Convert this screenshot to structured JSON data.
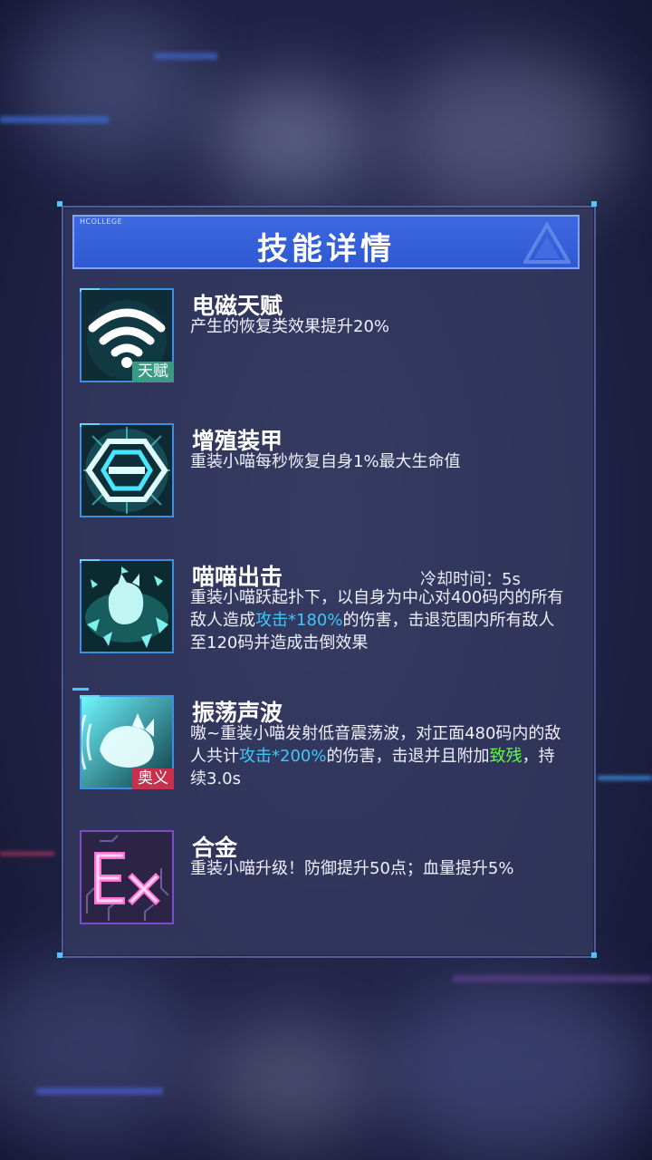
{
  "panel": {
    "tag": "HCOLLEGE",
    "title": "技能详情"
  },
  "skills": [
    {
      "name": "电磁天赋",
      "badge": "天赋",
      "icon": "wifi-signal-icon",
      "desc": "产生的恢复类效果提升20%"
    },
    {
      "name": "增殖装甲",
      "icon": "armor-hexagon-icon",
      "desc": "重装小喵每秒恢复自身1%最大生命值"
    },
    {
      "name": "喵喵出击",
      "icon": "cat-pounce-icon",
      "cooldown": "冷却时间：5s",
      "desc_a": "重装小喵跃起扑下，以自身为中心对400码内的所有敌人造成",
      "desc_hl": "攻击*180%",
      "desc_b": "的伤害，击退范围内所有敌人至120码并造成击倒效果"
    },
    {
      "name": "振荡声波",
      "badge": "奥义",
      "icon": "cat-sonic-wave-icon",
      "desc_a": "嗷~重装小喵发射低音震荡波，对正面480码内的敌人共计",
      "desc_hl": "攻击*200%",
      "desc_b": "的伤害，击退并且附加",
      "desc_hl2": "致残",
      "desc_c": "，持续3.0s"
    },
    {
      "name": "合金",
      "icon": "ex-circuit-icon",
      "desc": "重装小喵升级！防御提升50点；血量提升5%"
    }
  ],
  "colors": {
    "title_bar": "#3161d8",
    "highlight_blue": "#3cc8ff",
    "highlight_green": "#5dfc4a",
    "badge_talent": "#3a9a86",
    "badge_ultimate": "#c8304e"
  }
}
